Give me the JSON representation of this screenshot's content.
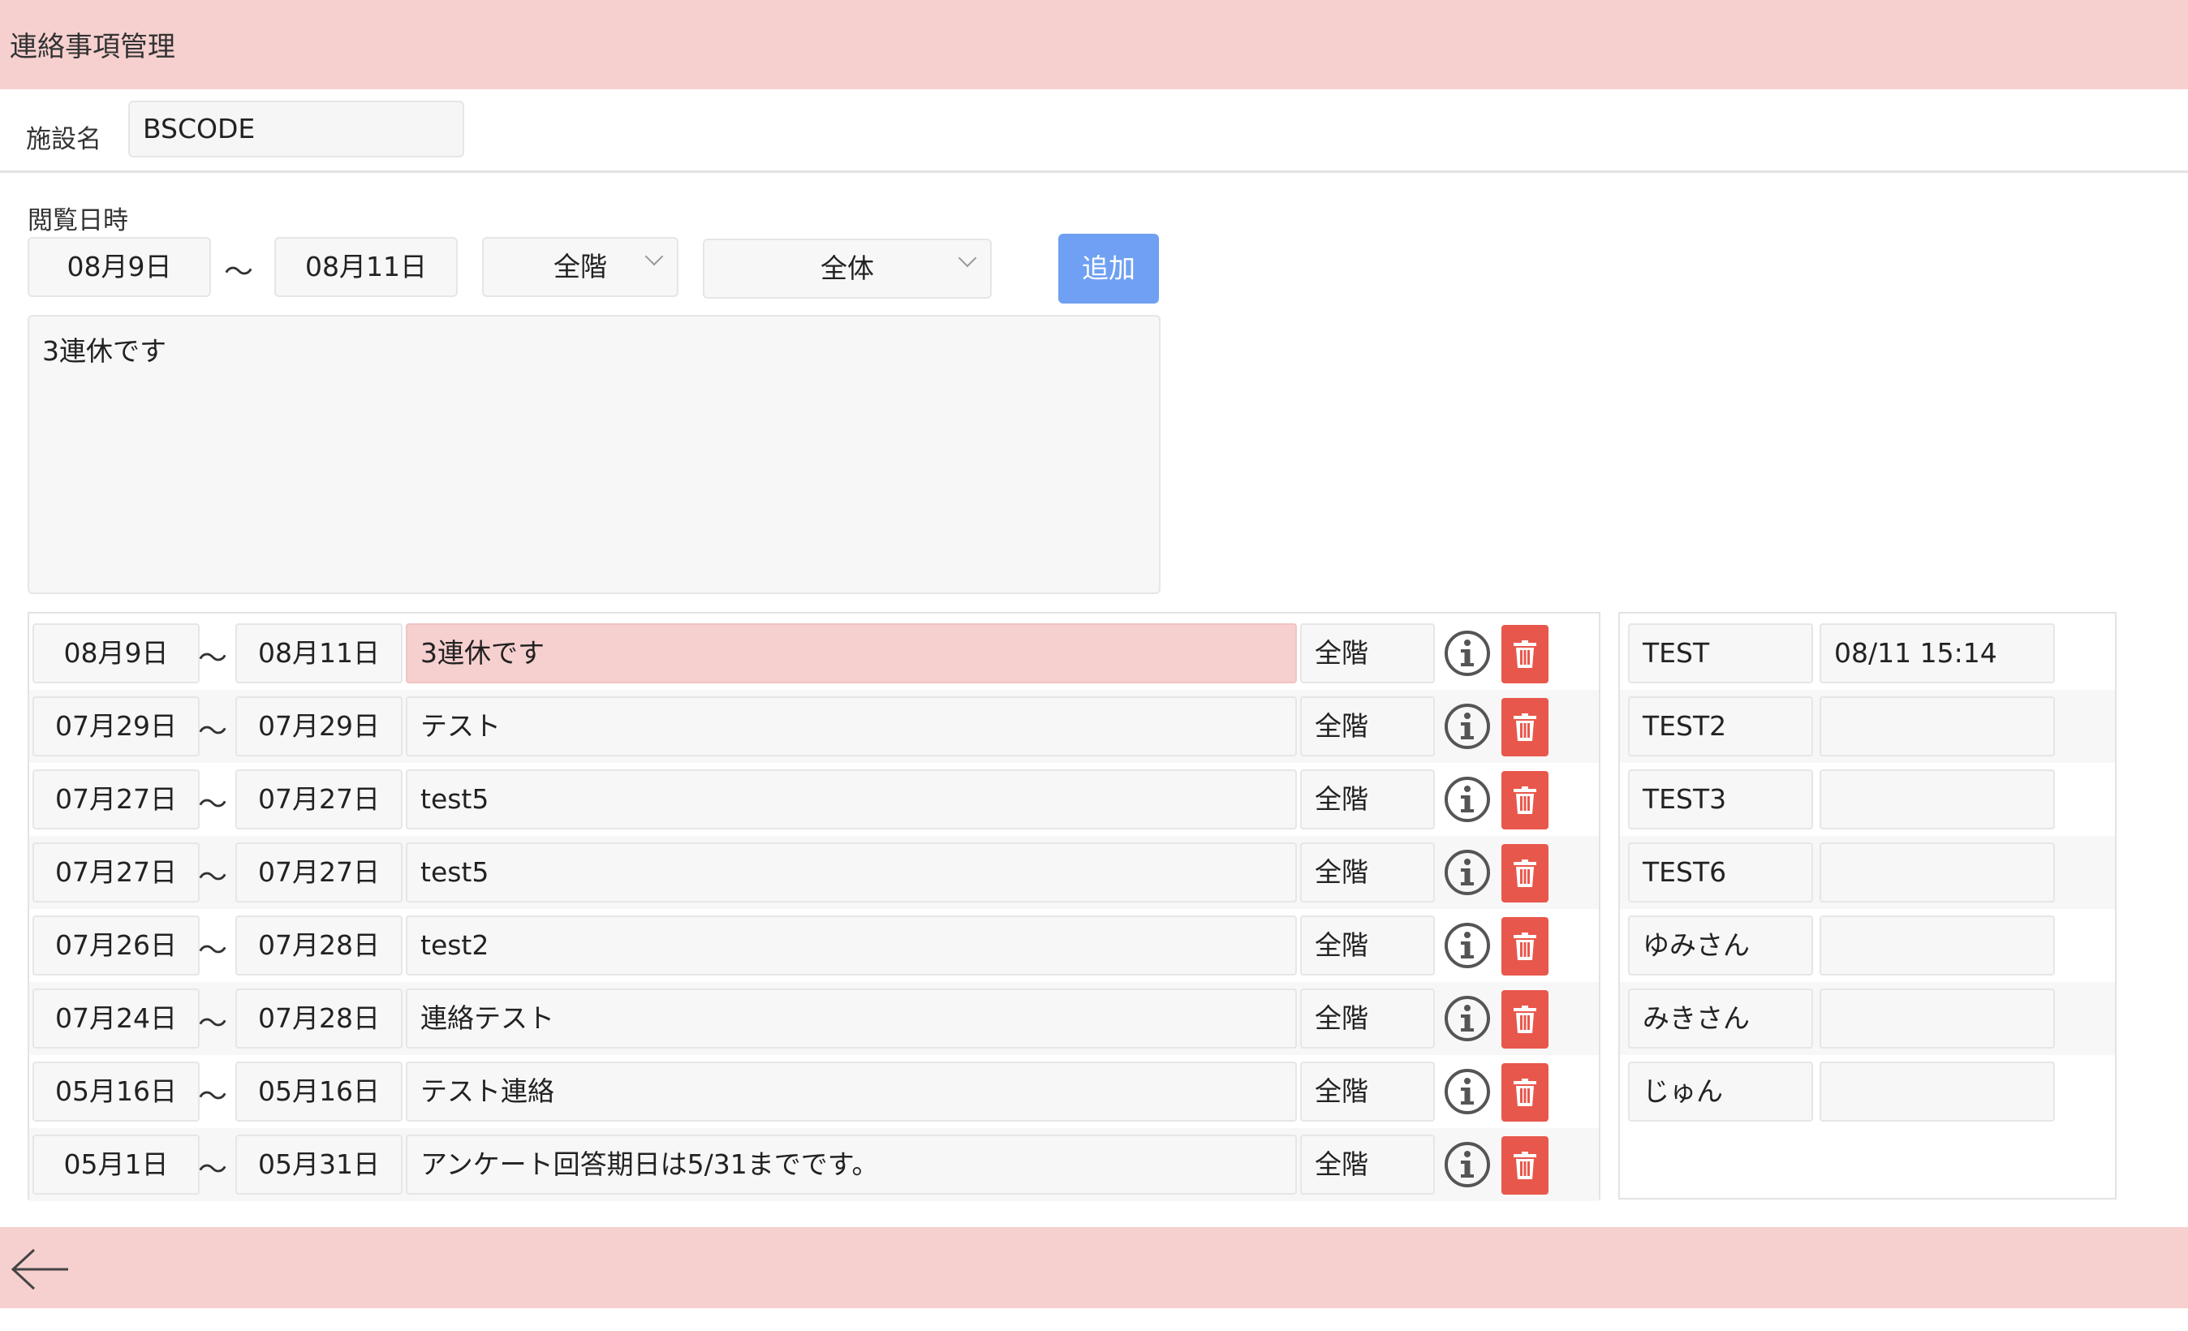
{
  "header": {
    "title": "連絡事項管理"
  },
  "facility": {
    "label": "施設名",
    "value": "BSCODE"
  },
  "form": {
    "viewing_label": "閲覧日時",
    "start_date": "08月9日",
    "range_sep": "〜",
    "end_date": "08月11日",
    "floor_select": "全階",
    "target_select": "全体",
    "add_label": "追加",
    "message": "3連休です"
  },
  "notices": [
    {
      "start": "08月9日",
      "end": "08月11日",
      "message": "3連休です",
      "floor": "全階",
      "highlighted": true
    },
    {
      "start": "07月29日",
      "end": "07月29日",
      "message": "テスト",
      "floor": "全階"
    },
    {
      "start": "07月27日",
      "end": "07月27日",
      "message": "test5",
      "floor": "全階"
    },
    {
      "start": "07月27日",
      "end": "07月27日",
      "message": "test5",
      "floor": "全階"
    },
    {
      "start": "07月26日",
      "end": "07月28日",
      "message": "test2",
      "floor": "全階"
    },
    {
      "start": "07月24日",
      "end": "07月28日",
      "message": "連絡テスト",
      "floor": "全階"
    },
    {
      "start": "05月16日",
      "end": "05月16日",
      "message": "テスト連絡",
      "floor": "全階"
    },
    {
      "start": "05月1日",
      "end": "05月31日",
      "message": "アンケート回答期日は5/31までです。",
      "floor": "全階"
    }
  ],
  "readers": [
    {
      "name": "TEST",
      "time": "08/11 15:14"
    },
    {
      "name": "TEST2",
      "time": ""
    },
    {
      "name": "TEST3",
      "time": ""
    },
    {
      "name": "TEST6",
      "time": ""
    },
    {
      "name": "ゆみさん",
      "time": ""
    },
    {
      "name": "みきさん",
      "time": ""
    },
    {
      "name": "じゅん",
      "time": ""
    }
  ],
  "colors": {
    "header_bg": "#f6d0cf",
    "add_button": "#6fa0f3",
    "delete_button": "#e8574b",
    "highlight_row": "#f6d0cf"
  },
  "icons": {
    "info": "info-circle-icon",
    "delete": "trash-icon",
    "back": "arrow-left-icon",
    "dropdown": "chevron-down-icon"
  }
}
